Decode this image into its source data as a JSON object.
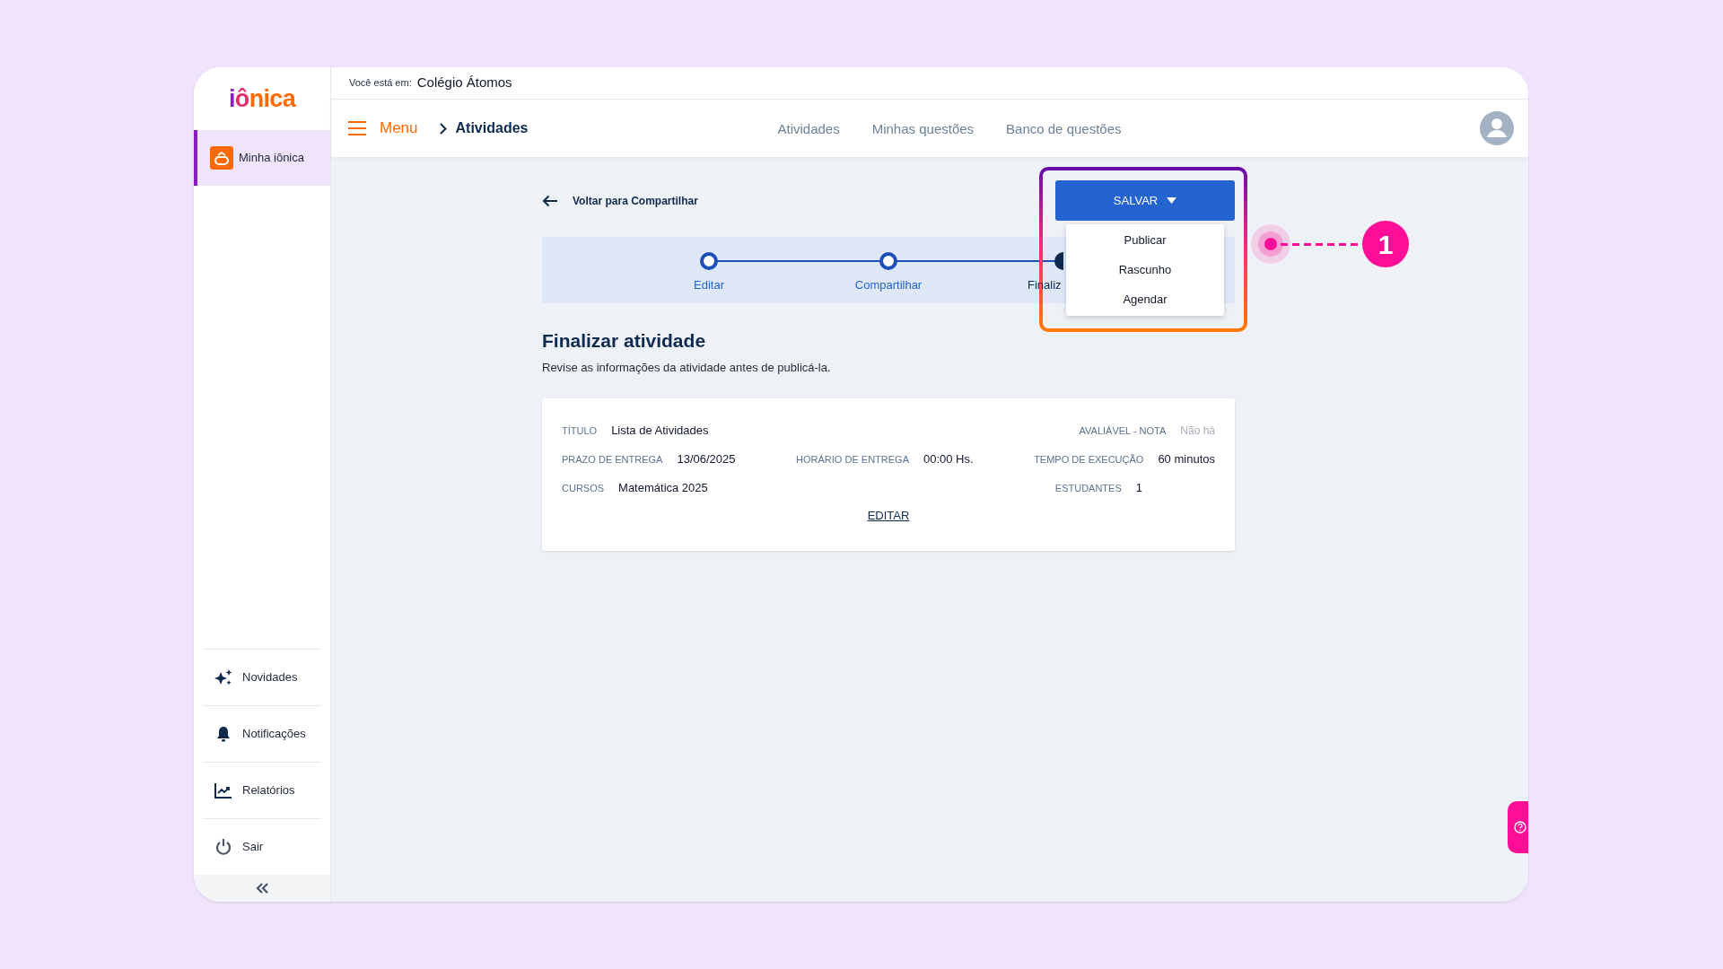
{
  "location": {
    "label": "Você está em:",
    "value": "Colégio Átomos"
  },
  "logo": "iônica",
  "sidebar": {
    "items": [
      {
        "label": "Minha iônica",
        "selected": true
      }
    ],
    "bottom_items": [
      {
        "label": "Novidades",
        "kind": "sparkles"
      },
      {
        "label": "Notificações",
        "kind": "bell"
      },
      {
        "label": "Relatórios",
        "kind": "chart"
      },
      {
        "label": "Sair",
        "kind": "power"
      }
    ]
  },
  "navbar": {
    "menu": "Menu",
    "breadcrumb": "Atividades",
    "tabs": [
      "Atividades",
      "Minhas questões",
      "Banco de questões"
    ]
  },
  "back_link": "Voltar para Compartilhar",
  "save_button": "SALVAR",
  "save_menu": [
    "Publicar",
    "Rascunho",
    "Agendar"
  ],
  "stepper": [
    {
      "label": "Editar",
      "current": false
    },
    {
      "label": "Compartilhar",
      "current": false
    },
    {
      "label": "Finaliz",
      "current": true
    }
  ],
  "page_title": "Finalizar atividade",
  "page_subtitle": "Revise as informações da atividade antes de publicá-la.",
  "summary": {
    "rows": [
      [
        {
          "label": "TÍTULO",
          "value": "Lista de Atividades",
          "empty": false
        },
        {
          "label": "AVALIÁVEL - NOTA",
          "value": "Não há",
          "empty": true
        }
      ],
      [
        {
          "label": "PRAZO DE ENTREGA",
          "value": "13/06/2025",
          "empty": false
        },
        {
          "label": "HORÁRIO DE ENTREGA",
          "value": "00:00 Hs.",
          "empty": false
        },
        {
          "label": "TEMPO DE EXECUÇÃO",
          "value": "60 minutos",
          "empty": false
        }
      ],
      [
        {
          "label": "CURSOS",
          "value": "Matemática 2025",
          "empty": false
        },
        {
          "label": "ESTUDANTES",
          "value": "1",
          "empty": false
        }
      ]
    ],
    "edit_link": "EDITAR"
  },
  "annotation": "1"
}
